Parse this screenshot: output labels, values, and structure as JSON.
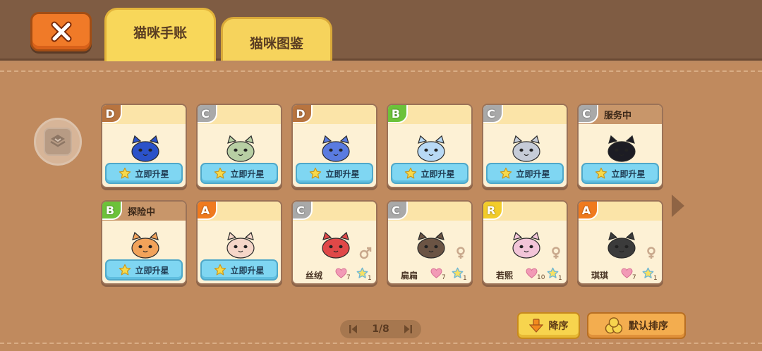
{
  "header": {
    "tabs": [
      {
        "label": "猫咪手账",
        "active": true
      },
      {
        "label": "猫咪图鉴",
        "active": false
      }
    ],
    "close_icon": "close-x-icon"
  },
  "side_button": {
    "icon": "layers-icon"
  },
  "cards": [
    {
      "rarity": "D",
      "status": "",
      "upgrade_label": "立即升星",
      "cat_color": "#2b52c9"
    },
    {
      "rarity": "C",
      "status": "",
      "upgrade_label": "立即升星",
      "cat_color": "#b8cfa4"
    },
    {
      "rarity": "D",
      "status": "",
      "upgrade_label": "立即升星",
      "cat_color": "#5a7be0"
    },
    {
      "rarity": "B",
      "status": "",
      "upgrade_label": "立即升星",
      "cat_color": "#b8d9f5"
    },
    {
      "rarity": "C",
      "status": "",
      "upgrade_label": "立即升星",
      "cat_color": "#c6ccd8"
    },
    {
      "rarity": "C",
      "status": "服务中",
      "upgrade_label": "立即升星",
      "cat_color": "#1c1c24"
    },
    {
      "rarity": "B",
      "status": "探险中",
      "upgrade_label": "立即升星",
      "cat_color": "#f2a35a"
    },
    {
      "rarity": "A",
      "status": "",
      "upgrade_label": "立即升星",
      "cat_color": "#f5d6c8"
    },
    {
      "rarity": "C",
      "status": "",
      "name": "丝绒",
      "hearts": "7",
      "stars": "1",
      "gender": "male",
      "cat_color": "#e04848"
    },
    {
      "rarity": "C",
      "status": "",
      "name": "扁扁",
      "hearts": "7",
      "stars": "1",
      "gender": "female",
      "cat_color": "#6b5444"
    },
    {
      "rarity": "R",
      "status": "",
      "name": "若熙",
      "hearts": "10",
      "stars": "1",
      "gender": "female",
      "cat_color": "#f2c5d8"
    },
    {
      "rarity": "A",
      "status": "",
      "name": "琪琪",
      "hearts": "7",
      "stars": "1",
      "gender": "female",
      "cat_color": "#3b3b3b"
    }
  ],
  "rarity_colors": {
    "D": "#b8743f",
    "C": "#a9a9a9",
    "B": "#6cc23a",
    "A": "#f07a1e",
    "R": "#f2cc2a"
  },
  "pager": {
    "text": "1/8"
  },
  "sort_button": {
    "label": "降序"
  },
  "default_sort_button": {
    "label": "默认排序"
  }
}
